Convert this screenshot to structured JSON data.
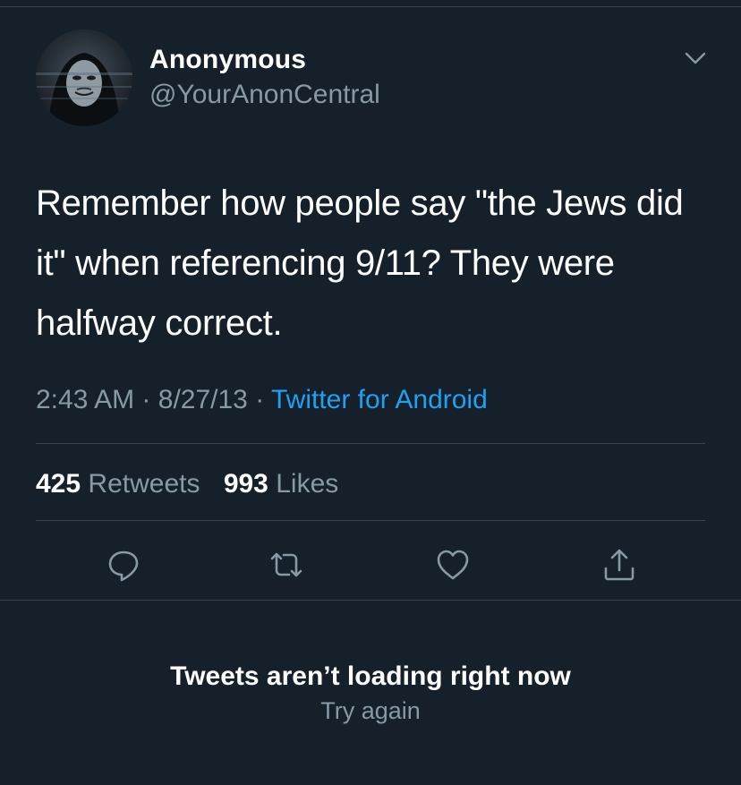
{
  "author": {
    "name": "Anonymous",
    "handle": "@YourAnonCentral"
  },
  "tweet": {
    "text": "Remember how people say \"the Jews did it\" when referencing 9/11? They were halfway correct.",
    "time": "2:43 AM",
    "date": "8/27/13",
    "separator": "·",
    "source": "Twitter for Android"
  },
  "stats": {
    "retweets_count": "425",
    "retweets_label": "Retweets",
    "likes_count": "993",
    "likes_label": "Likes"
  },
  "actions": [
    "reply-icon",
    "retweet-icon",
    "like-icon",
    "share-icon"
  ],
  "error": {
    "title": "Tweets aren’t loading right now",
    "retry": "Try again"
  },
  "colors": {
    "background": "#15202b",
    "secondary_text": "#8899a6",
    "accent": "#1da1f2",
    "divider": "#38444d"
  }
}
